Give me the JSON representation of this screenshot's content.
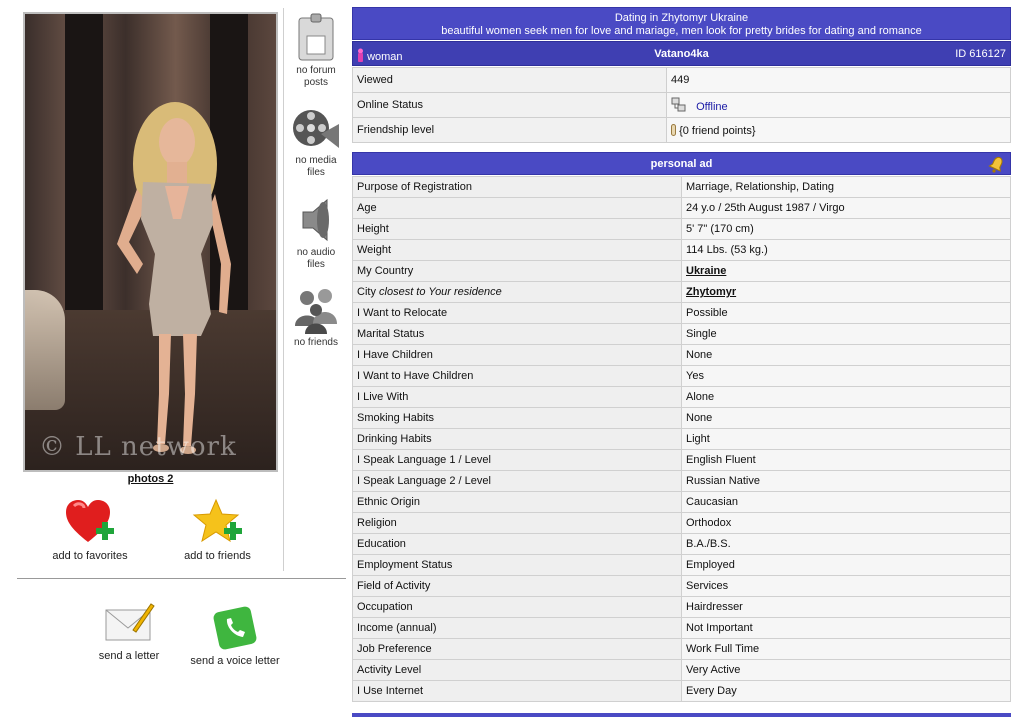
{
  "header": {
    "title": "Dating in Zhytomyr Ukraine",
    "subtitle": "beautiful women seek men for love and mariage, men look for pretty brides for dating and romance"
  },
  "profile_bar": {
    "gender": "woman",
    "nickname": "Vatano4ka",
    "id": "ID 616127"
  },
  "stats": [
    {
      "label": "Viewed",
      "value": "449"
    },
    {
      "label": "Online Status",
      "value": "Offline"
    },
    {
      "label": "Friendship level",
      "value": "{0 friend points}"
    }
  ],
  "photo": {
    "watermark": "© LL network",
    "link_label": "photos 2"
  },
  "actions": {
    "add_favorites": "add to favorites",
    "add_friends": "add to friends",
    "send_letter": "send a letter",
    "send_voice": "send a voice letter"
  },
  "mid_column": {
    "forum": [
      "no forum",
      "posts"
    ],
    "media": [
      "no media",
      "files"
    ],
    "audio": [
      "no audio",
      "files"
    ],
    "friends": [
      "no friends"
    ]
  },
  "personal_ad": {
    "title": "personal ad",
    "rows": [
      {
        "label": "Purpose of Registration",
        "value": "Marriage, Relationship, Dating"
      },
      {
        "label": "Age",
        "value": "24 y.o / 25th August 1987 / Virgo"
      },
      {
        "label": "Height",
        "value": "5' 7\" (170 cm)"
      },
      {
        "label": "Weight",
        "value": "114 Lbs. (53 kg.)"
      },
      {
        "label": "My Country",
        "value": "Ukraine",
        "link": true
      },
      {
        "label": "City",
        "label_italic": "closest to Your residence",
        "value": "Zhytomyr",
        "link": true
      },
      {
        "label": "I Want to Relocate",
        "value": "Possible"
      },
      {
        "label": "Marital Status",
        "value": "Single"
      },
      {
        "label": "I Have Children",
        "value": "None"
      },
      {
        "label": "I Want to Have Children",
        "value": "Yes"
      },
      {
        "label": "I Live With",
        "value": "Alone"
      },
      {
        "label": "Smoking Habits",
        "value": "None"
      },
      {
        "label": "Drinking Habits",
        "value": "Light"
      },
      {
        "label": "I Speak Language 1 / Level",
        "value": "English Fluent"
      },
      {
        "label": "I Speak Language 2 / Level",
        "value": "Russian Native"
      },
      {
        "label": "Ethnic Origin",
        "value": "Caucasian"
      },
      {
        "label": "Religion",
        "value": "Orthodox"
      },
      {
        "label": "Education",
        "value": "B.A./B.S."
      },
      {
        "label": "Employment Status",
        "value": "Employed"
      },
      {
        "label": "Field of Activity",
        "value": "Services"
      },
      {
        "label": "Occupation",
        "value": "Hairdresser"
      },
      {
        "label": "Income (annual)",
        "value": "Not Important"
      },
      {
        "label": "Job Preference",
        "value": "Work Full Time"
      },
      {
        "label": "Activity Level",
        "value": "Very Active"
      },
      {
        "label": "I Use Internet",
        "value": "Every Day"
      }
    ]
  },
  "colors": {
    "header_bg": "#4a4ac4",
    "offline_link": "#1a1aa6"
  },
  "icons": {
    "gender": "female-icon",
    "online": "network-offline-icon",
    "friendship": "friendship-meter-icon",
    "ad": "bell-icon"
  }
}
